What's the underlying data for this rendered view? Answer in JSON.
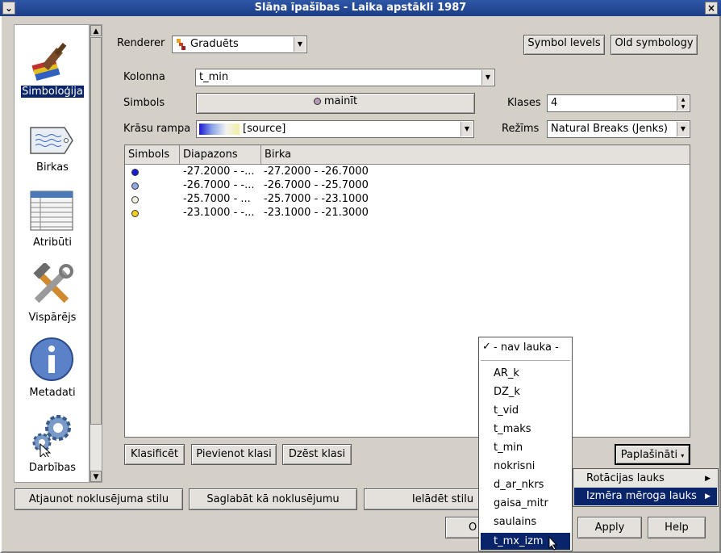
{
  "window": {
    "title": "Slāņa īpašības - Laika apstākli 1987",
    "close_glyph": "×",
    "menu_glyph": "⌄"
  },
  "sidebar": {
    "items": [
      {
        "label": "Simboloģija",
        "icon": "paintbrush-icon"
      },
      {
        "label": "Birkas",
        "icon": "tag-icon"
      },
      {
        "label": "Atribūti",
        "icon": "table-icon"
      },
      {
        "label": "Vispārējs",
        "icon": "tools-icon"
      },
      {
        "label": "Metadati",
        "icon": "info-icon"
      },
      {
        "label": "Darbības",
        "icon": "gears-icon"
      }
    ],
    "scroll_up": "▲",
    "scroll_down": "▼"
  },
  "renderer": {
    "label": "Renderer",
    "value": "Graduēts"
  },
  "buttons": {
    "symbol_levels": "Symbol levels",
    "old_symbology": "Old symbology",
    "classify": "Klasificēt",
    "add_class": "Pievienot klasi",
    "delete_class": "Dzēst klasi",
    "advanced": "Paplašināti",
    "restore_default": "Atjaunot noklusējuma stilu",
    "save_default": "Saglabāt kā noklusējumu",
    "load_style": "Ielādēt stilu",
    "ok": "O",
    "apply": "Apply",
    "help": "Help"
  },
  "form": {
    "column_label": "Kolonna",
    "column_value": "t_min",
    "symbol_label": "Simbols",
    "symbol_button": "mainīt",
    "classes_label": "Klases",
    "classes_value": "4",
    "ramp_label": "Krāsu rampa",
    "ramp_value": "[source]",
    "mode_label": "Režīms",
    "mode_value": "Natural Breaks (Jenks)"
  },
  "table": {
    "headers": [
      "Simbols",
      "Diapazons",
      "Birka"
    ],
    "rows": [
      {
        "color": "#1a1ad6",
        "range": "-27.2000 - -...",
        "label": "-27.2000 - -26.7000"
      },
      {
        "color": "#8fa8e8",
        "range": "-26.7000 - -...",
        "label": "-26.7000 - -25.7000"
      },
      {
        "color": "#f2f2e0",
        "range": "-25.7000 - ...",
        "label": "-25.7000 - -23.1000"
      },
      {
        "color": "#f0d020",
        "range": "-23.1000 - -...",
        "label": "-23.1000 - -21.3000"
      }
    ]
  },
  "menu_fields": {
    "none_item": "- nav lauka -",
    "check": "✓",
    "items": [
      "AR_k",
      "DZ_k",
      "t_vid",
      "t_maks",
      "t_min",
      "nokrisni",
      "d_ar_nkrs",
      "gaisa_mitr",
      "saulains",
      "t_mx_izm"
    ],
    "selected": "t_mx_izm"
  },
  "menu_advanced": {
    "items": [
      {
        "label": "Rotācijas lauks",
        "submenu": "▶"
      },
      {
        "label": "Izmēra mēroga lauks",
        "submenu": "▶"
      }
    ]
  }
}
